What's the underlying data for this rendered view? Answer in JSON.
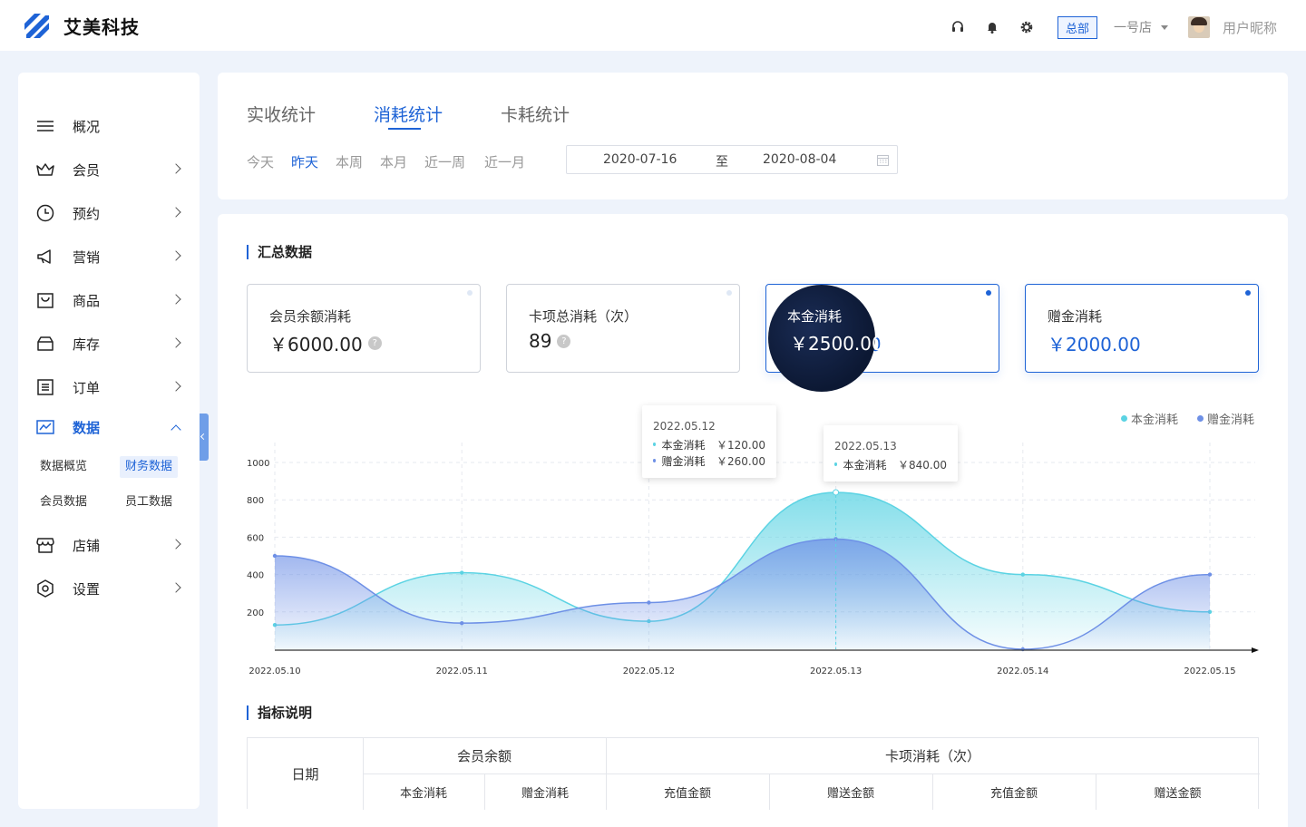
{
  "brand": {
    "name": "艾美科技",
    "color": "#1e63d6"
  },
  "topbar": {
    "icons": [
      "headset-icon",
      "bell-icon",
      "gear-icon"
    ],
    "hq_badge": "总部",
    "store": "一号店",
    "username": "用户昵称"
  },
  "sidebar": {
    "items": [
      {
        "label": "概况",
        "icon": "menu-icon"
      },
      {
        "label": "会员",
        "icon": "crown-icon"
      },
      {
        "label": "预约",
        "icon": "clock-icon"
      },
      {
        "label": "营销",
        "icon": "megaphone-icon"
      },
      {
        "label": "商品",
        "icon": "bag-icon"
      },
      {
        "label": "库存",
        "icon": "box-icon"
      },
      {
        "label": "订单",
        "icon": "list-icon"
      },
      {
        "label": "数据",
        "icon": "chart-icon",
        "active": true
      },
      {
        "label": "店铺",
        "icon": "store-icon"
      },
      {
        "label": "设置",
        "icon": "settings-icon"
      }
    ],
    "data_sub": [
      "数据概览",
      "财务数据",
      "会员数据",
      "员工数据"
    ],
    "data_sub_active": "财务数据"
  },
  "tabs": [
    "实收统计",
    "消耗统计",
    "卡耗统计"
  ],
  "active_tab": "消耗统计",
  "quick_ranges": [
    "今天",
    "昨天",
    "本周",
    "本月",
    "近一周",
    "近一月"
  ],
  "active_range": "昨天",
  "date_range": {
    "start": "2020-07-16",
    "sep": "至",
    "end": "2020-08-04"
  },
  "summary": {
    "title": "汇总数据",
    "cards": [
      {
        "label": "会员余额消耗",
        "value": "￥6000.00",
        "help": "?"
      },
      {
        "label": "卡项总消耗（次）",
        "value": "89",
        "help": "?"
      },
      {
        "label": "本金消耗",
        "value": "￥2500.00"
      },
      {
        "label": "赠金消耗",
        "value": "￥2000.00"
      }
    ]
  },
  "chart_data": {
    "type": "area",
    "x": [
      "2022.05.10",
      "2022.05.11",
      "2022.05.12",
      "2022.05.13",
      "2022.05.14",
      "2022.05.15"
    ],
    "yticks": [
      200,
      400,
      600,
      800,
      1000
    ],
    "ylim": [
      0,
      1000
    ],
    "series": [
      {
        "name": "本金消耗",
        "color": "#5bd3e3",
        "values": [
          130,
          410,
          150,
          840,
          400,
          200
        ]
      },
      {
        "name": "赠金消耗",
        "color": "#6e90e6",
        "values": [
          500,
          140,
          250,
          590,
          0,
          400
        ]
      }
    ],
    "legend": "top-right",
    "grid": true,
    "tooltips": [
      {
        "date": "2022.05.12",
        "rows": [
          {
            "name": "本金消耗",
            "value": "￥120.00",
            "color": "#5bd3e3"
          },
          {
            "name": "赠金消耗",
            "value": "￥260.00",
            "color": "#6e90e6"
          }
        ]
      },
      {
        "date": "2022.05.13",
        "rows": [
          {
            "name": "本金消耗",
            "value": "￥840.00",
            "color": "#5bd3e3"
          }
        ]
      }
    ]
  },
  "indicators": {
    "title": "指标说明",
    "header_date": "日期",
    "group1": "会员余额",
    "group1_cols": [
      "本金消耗",
      "赠金消耗"
    ],
    "group2": "卡项消耗（次）",
    "group2_cols": [
      "充值金额",
      "赠送金额",
      "充值金额",
      "赠送金额"
    ]
  }
}
